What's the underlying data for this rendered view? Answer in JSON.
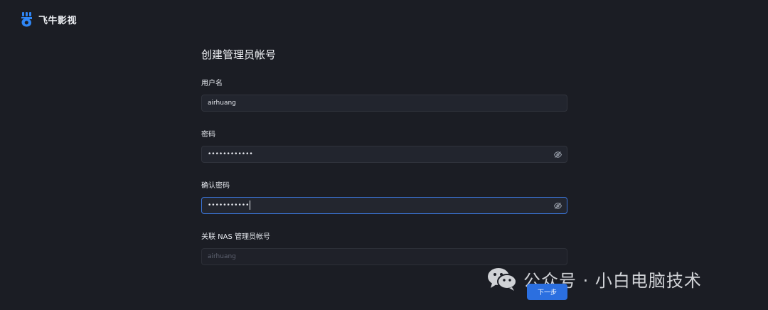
{
  "app": {
    "brand_name": "飞牛影视",
    "logo_icon": "fnos-logo-icon",
    "accent_color": "#2b6fe0"
  },
  "form": {
    "title": "创建管理员帐号",
    "fields": [
      {
        "label": "用户名",
        "value": "airhuang"
      },
      {
        "label": "密码",
        "value": "••••••••••••",
        "toggle_icon": "eye-off-icon"
      },
      {
        "label": "确认密码",
        "value": "•••••••••••",
        "toggle_icon": "eye-off-icon",
        "focused": true
      },
      {
        "label": "关联 NAS 管理员帐号",
        "placeholder": "airhuang",
        "disabled": true
      }
    ],
    "next_label": "下一步"
  },
  "watermark": {
    "icon": "wechat-icon",
    "text": "公众号 · 小白电脑技术"
  }
}
